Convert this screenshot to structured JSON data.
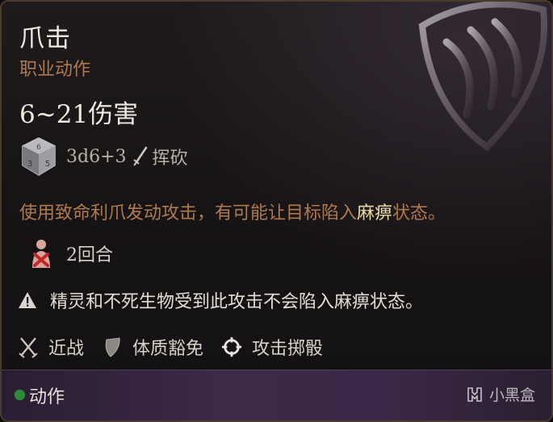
{
  "ability": {
    "name": "爪击",
    "category": "职业动作",
    "damage_range": "6~21伤害",
    "dice_formula": "3d6+3",
    "damage_type": "挥砍"
  },
  "description": {
    "before": "使用致命利爪发动攻击，有可能让目标陷入",
    "keyword": "麻痹",
    "after": "状态。"
  },
  "duration": "2回合",
  "warning": "精灵和不死生物受到此攻击不会陷入麻痹状态。",
  "properties": [
    {
      "label": "近战",
      "icon": "crossed-swords-icon"
    },
    {
      "label": "体质豁免",
      "icon": "shield-icon"
    },
    {
      "label": "攻击掷骰",
      "icon": "crosshair-icon"
    }
  ],
  "footer": {
    "action_label": "动作",
    "watermark": "小黑盒"
  },
  "colors": {
    "title": "#f0e9e1",
    "subtitle": "#b07a4c",
    "keyword": "#e9dca4",
    "action_dot": "#2f8a3c"
  }
}
